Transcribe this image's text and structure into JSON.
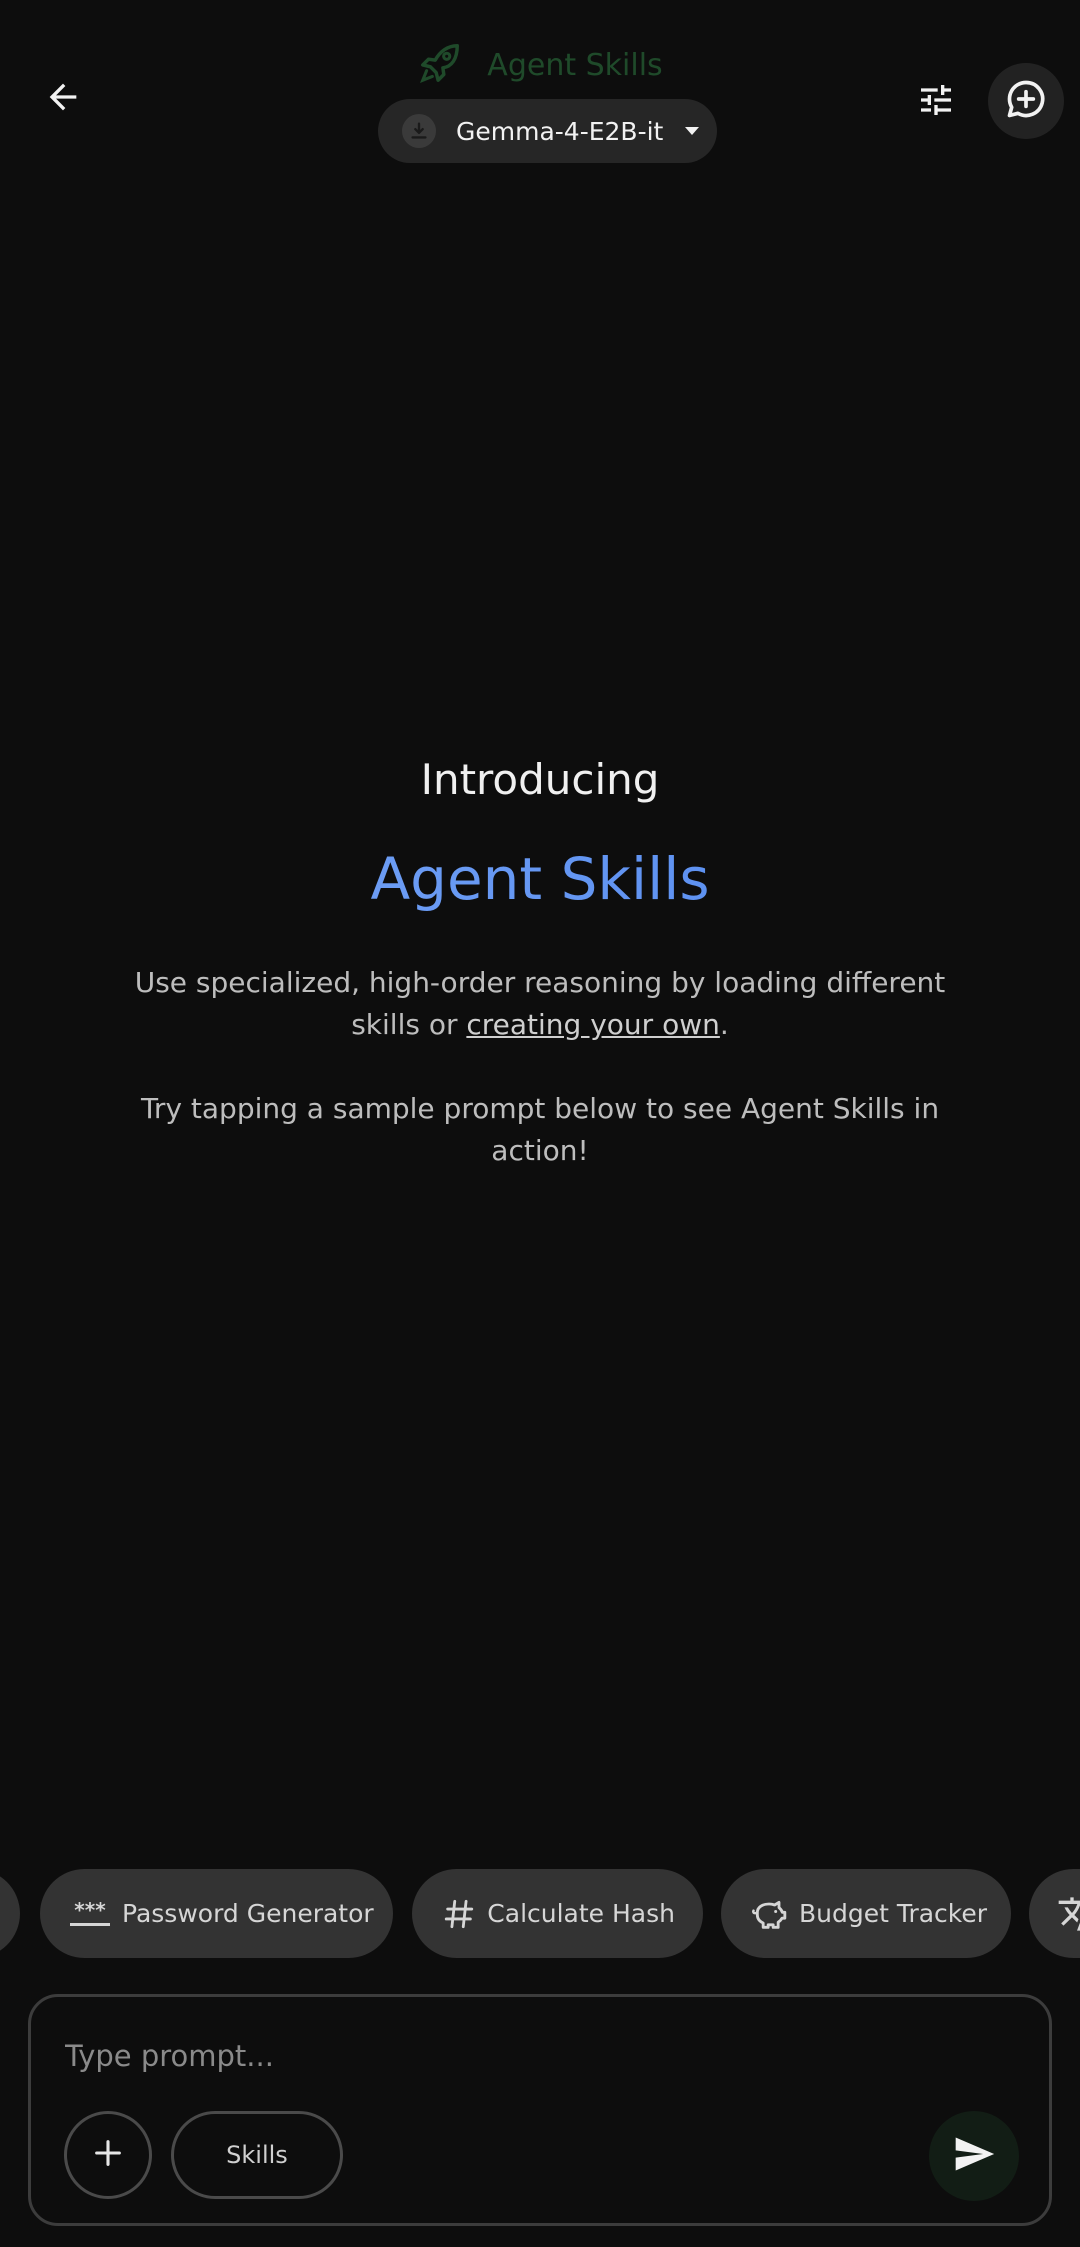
{
  "header": {
    "app_title": "Agent Skills",
    "model_name": "Gemma-4-E2B-it",
    "icons": {
      "back": "arrow-left-icon",
      "app": "rocket-icon",
      "model_status": "download-icon",
      "caret": "caret-down-icon",
      "tune": "tune-icon",
      "new_chat": "chat-add-icon"
    }
  },
  "intro": {
    "heading": "Introducing",
    "title": "Agent Skills",
    "desc_before": "Use specialized, high-order reasoning by loading different skills or ",
    "desc_link": "creating your own",
    "desc_after": ".",
    "try_text": "Try tapping a sample prompt below to see Agent Skills in action!"
  },
  "chips": [
    {
      "label": "Password Generator",
      "icon": "password-icon"
    },
    {
      "label": "Calculate Hash",
      "icon": "hash-icon"
    },
    {
      "label": "Budget Tracker",
      "icon": "piggy-bank-icon"
    }
  ],
  "input": {
    "placeholder": "Type prompt...",
    "value": "",
    "skills_label": "Skills",
    "icons": {
      "add": "plus-icon",
      "send": "send-icon"
    }
  },
  "colors": {
    "background": "#0d0d0d",
    "accent_blue": "#5b8ff0",
    "chip_bg": "#333333",
    "app_title_green": "#1f4a2a"
  }
}
